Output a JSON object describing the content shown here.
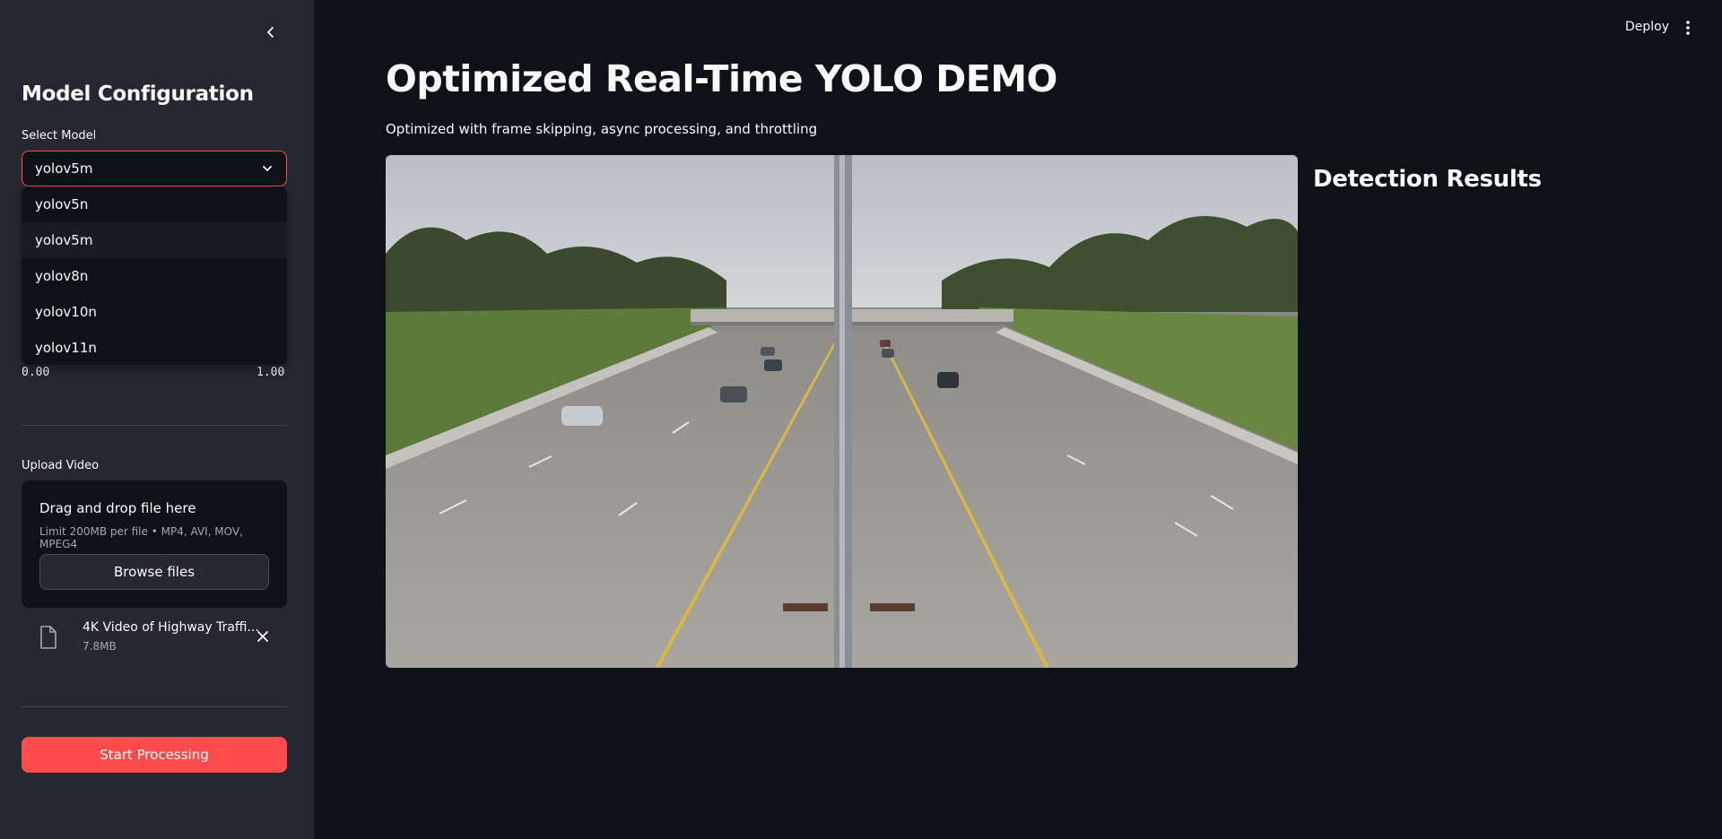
{
  "sidebar": {
    "title": "Model Configuration",
    "select_label": "Select Model",
    "selected_model": "yolov5m",
    "model_options": [
      "yolov5n",
      "yolov5m",
      "yolov8n",
      "yolov10n",
      "yolov11n"
    ],
    "slider_min": "0.00",
    "slider_max": "1.00",
    "upload_label": "Upload Video",
    "upload_title": "Drag and drop file here",
    "upload_limit": "Limit 200MB per file • MP4, AVI, MOV, MPEG4",
    "browse_label": "Browse files",
    "file_name": "4K Video of Highway Traffi...",
    "file_size": "7.8MB",
    "start_label": "Start Processing"
  },
  "header": {
    "deploy_label": "Deploy"
  },
  "main": {
    "title": "Optimized Real-Time YOLO DEMO",
    "subtitle": "Optimized with frame skipping, async processing, and throttling",
    "results_title": "Detection Results"
  },
  "colors": {
    "accent": "#ff4b4b",
    "background": "#0e1117",
    "sidebar": "#262730"
  },
  "icons": {
    "collapse": "chevron-left-icon",
    "dropdown": "chevron-down-icon",
    "file": "file-icon",
    "close": "close-icon",
    "menu": "kebab-menu-icon"
  }
}
